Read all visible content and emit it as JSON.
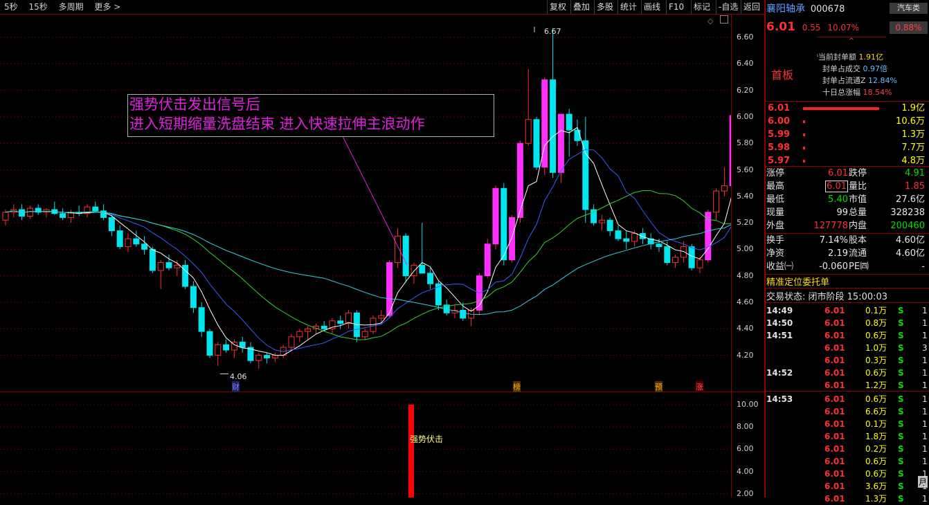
{
  "toolbar": {
    "left_items": [
      "5秒",
      "15秒",
      "多周期",
      "更多 >"
    ],
    "buttons": [
      "复权",
      "叠加",
      "多股",
      "统计",
      "画线",
      "F10",
      "标记",
      "-自选",
      "返回"
    ]
  },
  "chart": {
    "price_ticks": [
      "6.60",
      "6.40",
      "6.20",
      "6.00",
      "5.80",
      "5.60",
      "5.40",
      "5.20",
      "5.00",
      "4.80",
      "4.60",
      "4.40",
      "4.20"
    ],
    "volume_ticks": [
      "10.00",
      "8.00",
      "6.00",
      "4.00",
      "2.00"
    ],
    "high_label": "6.67",
    "low_label": "4.06",
    "annotation_line1": "强势伏击发出信号后",
    "annotation_line2": "进入短期缩量洗盘结束 进入快速拉伸主浪动作",
    "markers": [
      "财",
      "榜",
      "预",
      "涨"
    ],
    "signal_label": "强势伏击",
    "corner_label": "月"
  },
  "chart_data": {
    "type": "candlestick",
    "price_ylim": [
      4.06,
      6.67
    ],
    "candles": [
      [
        5.22,
        5.3,
        5.18,
        5.28
      ],
      [
        5.28,
        5.34,
        5.24,
        5.3
      ],
      [
        5.3,
        5.34,
        5.22,
        5.25
      ],
      [
        5.25,
        5.33,
        5.23,
        5.31
      ],
      [
        5.31,
        5.34,
        5.26,
        5.28
      ],
      [
        5.28,
        5.31,
        5.24,
        5.3
      ],
      [
        5.3,
        5.36,
        5.26,
        5.27
      ],
      [
        5.27,
        5.31,
        5.22,
        5.24
      ],
      [
        5.24,
        5.3,
        5.2,
        5.28
      ],
      [
        5.28,
        5.33,
        5.25,
        5.27
      ],
      [
        5.27,
        5.34,
        5.24,
        5.32
      ],
      [
        5.32,
        5.36,
        5.28,
        5.29
      ],
      [
        5.29,
        5.34,
        5.22,
        5.24
      ],
      [
        5.24,
        5.26,
        5.1,
        5.14
      ],
      [
        5.14,
        5.18,
        5.0,
        5.02
      ],
      [
        5.02,
        5.12,
        4.98,
        5.08
      ],
      [
        5.08,
        5.14,
        5.02,
        5.04
      ],
      [
        5.04,
        5.1,
        4.96,
        5.0
      ],
      [
        5.0,
        5.02,
        4.82,
        4.84
      ],
      [
        4.84,
        4.92,
        4.7,
        4.9
      ],
      [
        4.9,
        4.96,
        4.84,
        4.86
      ],
      [
        4.86,
        4.92,
        4.8,
        4.88
      ],
      [
        4.88,
        4.92,
        4.7,
        4.72
      ],
      [
        4.72,
        4.76,
        4.52,
        4.56
      ],
      [
        4.56,
        4.6,
        4.34,
        4.38
      ],
      [
        4.38,
        4.4,
        4.18,
        4.2
      ],
      [
        4.2,
        4.3,
        4.12,
        4.28
      ],
      [
        4.28,
        4.32,
        4.22,
        4.24
      ],
      [
        4.24,
        4.32,
        4.18,
        4.3
      ],
      [
        4.3,
        4.34,
        4.22,
        4.26
      ],
      [
        4.26,
        4.3,
        4.14,
        4.16
      ],
      [
        4.16,
        4.22,
        4.1,
        4.2
      ],
      [
        4.2,
        4.22,
        4.14,
        4.18
      ],
      [
        4.18,
        4.22,
        4.15,
        4.2
      ],
      [
        4.2,
        4.28,
        4.18,
        4.26
      ],
      [
        4.26,
        4.36,
        4.24,
        4.34
      ],
      [
        4.34,
        4.4,
        4.3,
        4.38
      ],
      [
        4.38,
        4.42,
        4.32,
        4.4
      ],
      [
        4.4,
        4.44,
        4.36,
        4.42
      ],
      [
        4.42,
        4.46,
        4.38,
        4.4
      ],
      [
        4.4,
        4.48,
        4.36,
        4.46
      ],
      [
        4.46,
        4.5,
        4.4,
        4.44
      ],
      [
        4.44,
        4.54,
        4.4,
        4.52
      ],
      [
        4.52,
        4.54,
        4.3,
        4.34
      ],
      [
        4.34,
        4.4,
        4.32,
        4.38
      ],
      [
        4.38,
        4.5,
        4.36,
        4.48
      ],
      [
        4.48,
        4.54,
        4.44,
        4.5
      ],
      [
        4.5,
        4.92,
        4.48,
        4.9
      ],
      [
        4.9,
        5.16,
        4.86,
        5.1
      ],
      [
        5.1,
        5.12,
        4.76,
        4.8
      ],
      [
        4.8,
        4.9,
        4.74,
        4.88
      ],
      [
        4.88,
        5.2,
        4.84,
        4.82
      ],
      [
        4.82,
        4.86,
        4.7,
        4.74
      ],
      [
        4.74,
        4.76,
        4.54,
        4.58
      ],
      [
        4.58,
        4.62,
        4.5,
        4.52
      ],
      [
        4.52,
        4.58,
        4.48,
        4.54
      ],
      [
        4.54,
        4.6,
        4.46,
        4.48
      ],
      [
        4.48,
        4.56,
        4.42,
        4.54
      ],
      [
        4.54,
        4.82,
        4.5,
        4.8
      ],
      [
        4.8,
        5.08,
        4.78,
        5.04
      ],
      [
        5.04,
        5.48,
        5.0,
        5.46
      ],
      [
        5.46,
        5.5,
        4.88,
        4.92
      ],
      [
        4.92,
        5.26,
        4.9,
        5.24
      ],
      [
        5.24,
        5.82,
        5.2,
        5.8
      ],
      [
        5.8,
        6.36,
        5.78,
        5.98
      ],
      [
        5.98,
        6.0,
        5.6,
        5.62
      ],
      [
        5.62,
        6.3,
        5.56,
        6.28
      ],
      [
        6.28,
        6.67,
        5.54,
        5.58
      ],
      [
        5.58,
        6.0,
        5.5,
        6.02
      ],
      [
        6.02,
        6.06,
        5.7,
        5.9
      ],
      [
        5.9,
        5.98,
        5.78,
        5.82
      ],
      [
        5.82,
        6.0,
        5.2,
        5.3
      ],
      [
        5.3,
        5.34,
        5.18,
        5.2
      ],
      [
        5.2,
        5.26,
        5.14,
        5.22
      ],
      [
        5.22,
        5.24,
        5.1,
        5.14
      ],
      [
        5.14,
        5.18,
        5.06,
        5.08
      ],
      [
        5.08,
        5.14,
        5.0,
        5.06
      ],
      [
        5.06,
        5.14,
        5.02,
        5.12
      ],
      [
        5.12,
        5.16,
        5.04,
        5.08
      ],
      [
        5.08,
        5.12,
        5.0,
        5.04
      ],
      [
        5.04,
        5.08,
        4.98,
        5.02
      ],
      [
        5.02,
        5.06,
        4.88,
        4.9
      ],
      [
        4.9,
        4.96,
        4.86,
        4.94
      ],
      [
        4.94,
        5.06,
        4.9,
        5.02
      ],
      [
        5.02,
        5.04,
        4.84,
        4.86
      ],
      [
        4.86,
        4.94,
        4.82,
        4.92
      ],
      [
        4.92,
        5.3,
        4.9,
        5.28
      ],
      [
        5.28,
        5.46,
        5.22,
        5.44
      ],
      [
        5.44,
        5.62,
        5.4,
        5.48
      ],
      [
        5.48,
        6.01,
        5.46,
        6.01
      ]
    ],
    "volume_signal_value": 10.0
  },
  "stock": {
    "name": "襄阳轴承",
    "code": "000678",
    "sector_tag": "汽车类",
    "price": "6.01",
    "change": "0.55",
    "change_pct": "10.07%",
    "sector_pct": "0.88%",
    "board_label": "首板",
    "seal_rows": [
      {
        "label": "当前封单额",
        "value": "1.91亿"
      },
      {
        "label": "封单占成交",
        "value": "0.97倍"
      },
      {
        "label": "封单占流通Z",
        "value": "12.84%"
      },
      {
        "label": "十日总涨幅",
        "value": "18.54%"
      }
    ]
  },
  "order_book": [
    {
      "price": "6.01",
      "vol": "1.9亿",
      "bar": 1.0
    },
    {
      "price": "6.00",
      "vol": "10.6万",
      "bar": 0.02
    },
    {
      "price": "5.99",
      "vol": "1.3万",
      "bar": 0.01
    },
    {
      "price": "5.98",
      "vol": "7.7万",
      "bar": 0.01
    },
    {
      "price": "5.97",
      "vol": "4.8万",
      "bar": 0.01
    }
  ],
  "stats": [
    {
      "l1": "涨停",
      "v1": "6.01",
      "c1": "red",
      "l2": "跌停",
      "v2": "4.91",
      "c2": "green"
    },
    {
      "l1": "最高",
      "v1": "6.01",
      "c1": "red",
      "l2": "量比",
      "v2": "1.85",
      "c2": "red"
    },
    {
      "l1": "最低",
      "v1": "5.40",
      "c1": "green",
      "l2": "市值",
      "v2": "27.6亿",
      "c2": "white"
    },
    {
      "l1": "现量",
      "v1": "99",
      "c1": "white",
      "l2": "总量",
      "v2": "328238",
      "c2": "white"
    },
    {
      "l1": "外盘",
      "v1": "127778",
      "c1": "red",
      "l2": "内盘",
      "v2": "200460",
      "c2": "green"
    },
    {
      "l1": "换手",
      "v1": "7.14%",
      "c1": "white",
      "l2": "股本",
      "v2": "4.60亿",
      "c2": "white"
    },
    {
      "l1": "净资",
      "v1": "2.19",
      "c1": "white",
      "l2": "流通",
      "v2": "4.60亿",
      "c2": "white"
    },
    {
      "l1": "收益㈠",
      "v1": "-0.060",
      "c1": "white",
      "l2": "PE㈣",
      "v2": "-",
      "c2": "white"
    }
  ],
  "order_panel_title": "精准定位委托单",
  "trade_status": "交易状态: 闭市阶段 15:00:03",
  "ticks": [
    {
      "time": "14:49",
      "price": "6.01",
      "vol": "0.1万",
      "side": "S",
      "n": "1"
    },
    {
      "time": "14:50",
      "price": "6.01",
      "vol": "0.8万",
      "side": "S",
      "n": "1"
    },
    {
      "time": "14:51",
      "price": "6.01",
      "vol": "0.6万",
      "side": "S",
      "n": "1"
    },
    {
      "time": "",
      "price": "6.01",
      "vol": "1.0万",
      "side": "S",
      "n": "3"
    },
    {
      "time": "",
      "price": "6.01",
      "vol": "0.3万",
      "side": "S",
      "n": "1"
    },
    {
      "time": "14:52",
      "price": "6.01",
      "vol": "0.6万",
      "side": "S",
      "n": "1"
    },
    {
      "time": "",
      "price": "6.01",
      "vol": "1.2万",
      "side": "S",
      "n": "1"
    },
    {
      "time": "14:53",
      "price": "6.01",
      "vol": "0.6万",
      "side": "S",
      "n": "1"
    },
    {
      "time": "",
      "price": "6.01",
      "vol": "6.6万",
      "side": "S",
      "n": "1"
    },
    {
      "time": "",
      "price": "6.01",
      "vol": "0.1万",
      "side": "S",
      "n": "1"
    },
    {
      "time": "",
      "price": "6.01",
      "vol": "1.8万",
      "side": "S",
      "n": "1"
    },
    {
      "time": "",
      "price": "6.01",
      "vol": "0.2万",
      "side": "S",
      "n": "1"
    },
    {
      "time": "",
      "price": "6.01",
      "vol": "0.6万",
      "side": "S",
      "n": "1"
    },
    {
      "time": "",
      "price": "6.01",
      "vol": "0.6万",
      "side": "S",
      "n": "1"
    },
    {
      "time": "",
      "price": "6.01",
      "vol": "3.6万",
      "side": "S",
      "n": "1"
    },
    {
      "time": "",
      "price": "6.01",
      "vol": "1.3万",
      "side": "S",
      "n": "1"
    }
  ],
  "colors": {
    "up": "#ff3030",
    "down": "#00e5ee",
    "ma5": "#ffffff",
    "ma10": "#3a5cff",
    "ma20": "#32d232",
    "ma60": "#30d0e0",
    "annot": "#e020e0"
  }
}
